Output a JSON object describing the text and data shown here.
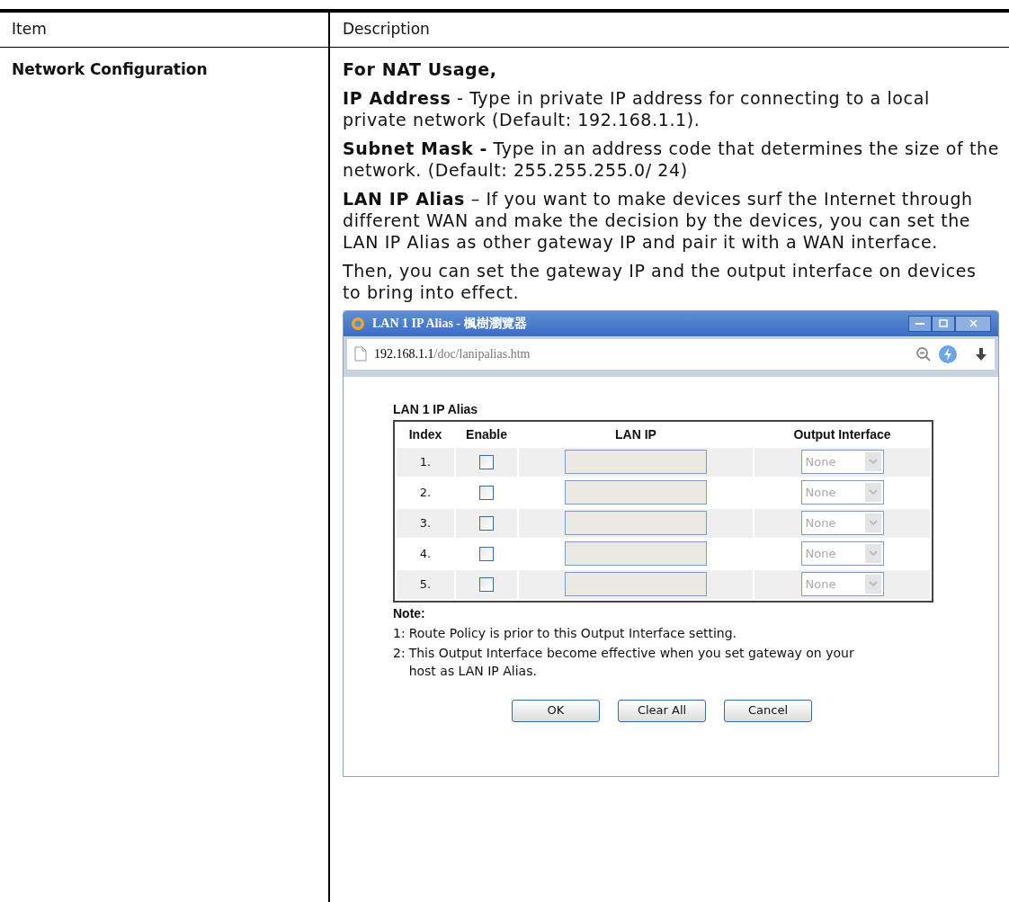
{
  "table": {
    "columns": [
      "Item",
      "Description"
    ],
    "rows": [
      {
        "item": "Network Configuration",
        "paragraphs": [
          {
            "text": "For NAT Usage,",
            "bold": true
          },
          {
            "text": "**IP Address** - Type in private IP address for connecting to a local private network (Default: 192.168.1.1).",
            "bold": false
          },
          {
            "text": "**Subnet Mask -** Type in an address code that determines the size of the network. (Default: 255.255.255.0/ 24)",
            "bold": false
          },
          {
            "text": "**LAN IP Alias** – If you want to make devices surf the Internet through different WAN and make the decision by the devices, you can set the LAN IP Alias as other gateway IP and pair it with a WAN interface.",
            "bold": false
          },
          {
            "text": "Then, you can set the gateway IP and the output interface on devices to bring into effect.",
            "bold": false
          }
        ],
        "window": {
          "title": "LAN 1 IP Alias - 楓樹瀏覽器",
          "url_host": "192.168.1.1",
          "url_path": "/doc/lanipalias.htm",
          "section_title": "LAN 1 IP Alias",
          "columns": [
            "Index",
            "Enable",
            "LAN IP",
            "Output Interface"
          ],
          "rows": [
            {
              "index": "1.",
              "enabled": false,
              "output": "None"
            },
            {
              "index": "2.",
              "enabled": false,
              "output": "None"
            },
            {
              "index": "3.",
              "enabled": false,
              "output": "None"
            },
            {
              "index": "4.",
              "enabled": false,
              "output": "None"
            },
            {
              "index": "5.",
              "enabled": false,
              "output": "None"
            }
          ],
          "note_label": "Note:",
          "notes": [
            {
              "num": "1:",
              "text": "Route Policy is prior to this Output Interface setting."
            },
            {
              "num": "2:",
              "text": "This Output Interface become effective when you set gateway on your host as LAN IP Alias."
            }
          ],
          "buttons": [
            "OK",
            "Clear All",
            "Cancel"
          ]
        }
      }
    ]
  }
}
